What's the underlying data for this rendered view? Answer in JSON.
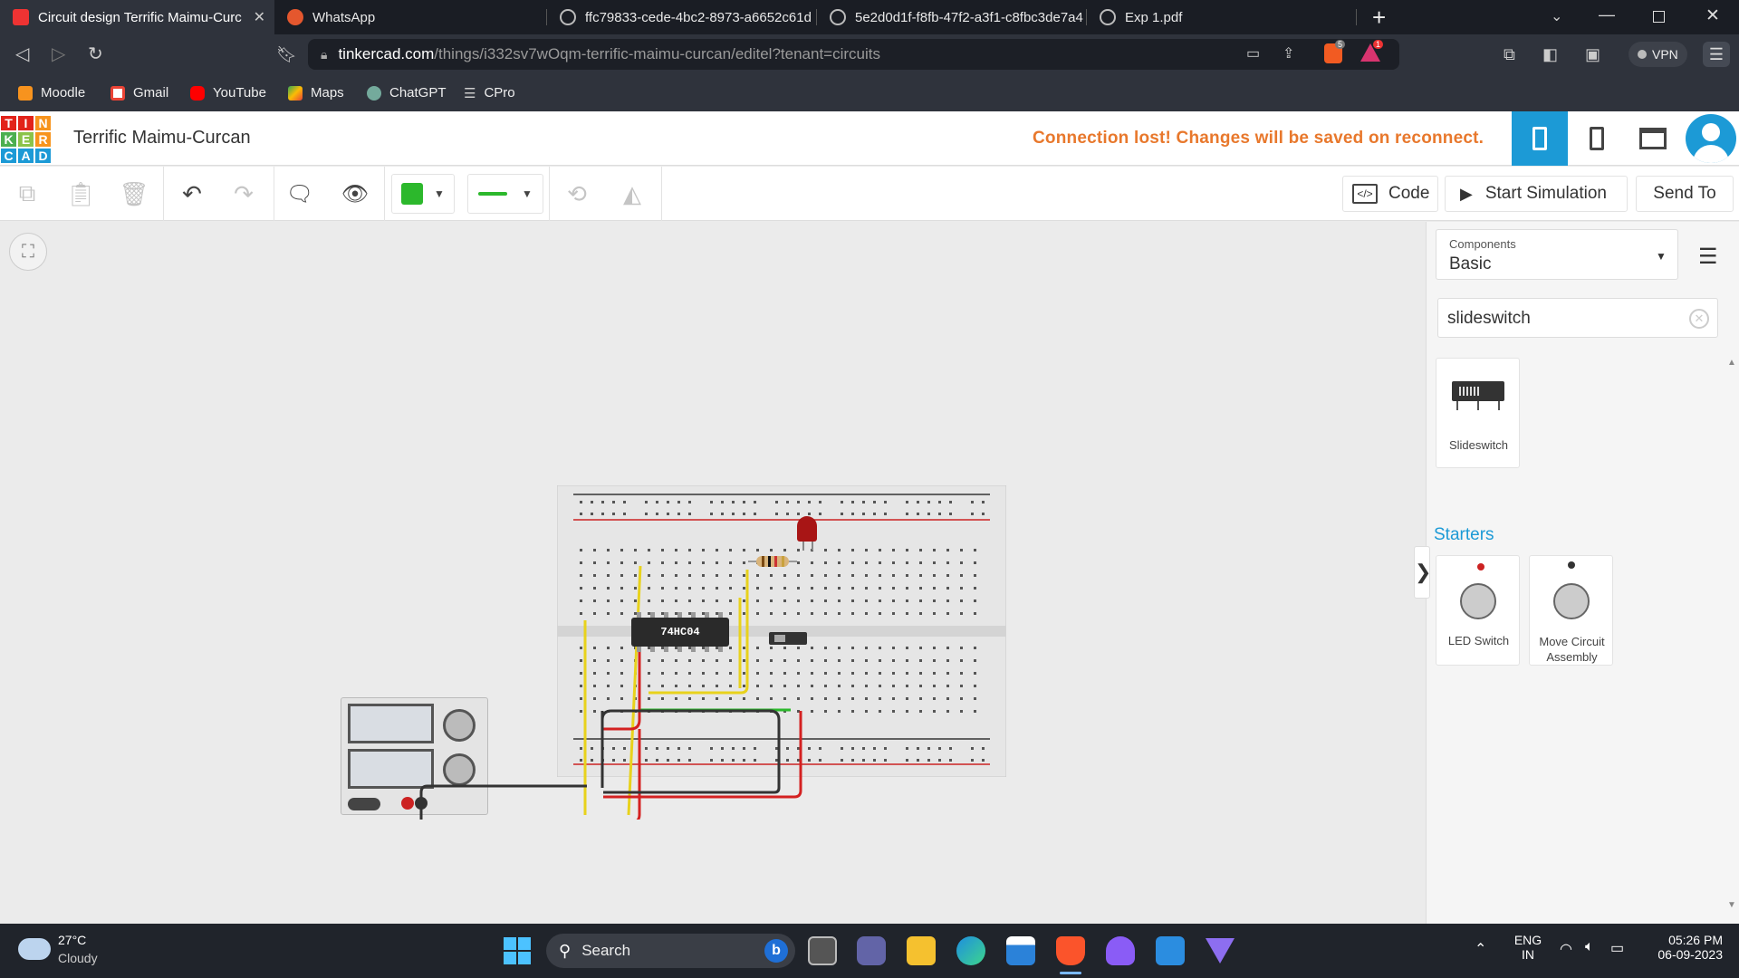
{
  "browser": {
    "tabs": [
      {
        "title": "Circuit design Terrific Maimu-Curc",
        "active": true
      },
      {
        "title": "WhatsApp",
        "active": false
      },
      {
        "title": "ffc79833-cede-4bc2-8973-a6652c61d",
        "active": false
      },
      {
        "title": "5e2d0d1f-f8fb-47f2-a3f1-c8fbc3de7a4",
        "active": false
      },
      {
        "title": "Exp 1.pdf",
        "active": false
      }
    ],
    "url_domain": "tinkercad.com",
    "url_path": "/things/i332sv7wOqm-terrific-maimu-curcan/editel?tenant=circuits",
    "vpn_label": "VPN",
    "brave_badge": "5",
    "alert_badge": "1",
    "bookmarks": [
      "Moodle",
      "Gmail",
      "YouTube",
      "Maps",
      "ChatGPT",
      "CPro"
    ]
  },
  "app": {
    "logo_letters": [
      "T",
      "I",
      "N",
      "K",
      "E",
      "R",
      "C",
      "A",
      "D"
    ],
    "title": "Terrific Maimu-Curcan",
    "status_message": "Connection lost! Changes will be saved on reconnect.",
    "code_label": "Code",
    "start_sim_label": "Start Simulation",
    "send_to_label": "Send To",
    "chip_label": "74HC04"
  },
  "panel": {
    "components_label": "Components",
    "components_value": "Basic",
    "search_value": "slideswitch",
    "results": [
      {
        "label": "Slideswitch"
      }
    ],
    "starters_title": "Starters",
    "starters": [
      {
        "label": "LED Switch"
      },
      {
        "label": "Move Circuit Assembly"
      }
    ]
  },
  "taskbar": {
    "temp": "27°C",
    "weather": "Cloudy",
    "search_placeholder": "Search",
    "lang_top": "ENG",
    "lang_bottom": "IN",
    "time": "05:26 PM",
    "date": "06-09-2023"
  },
  "colors": {
    "accent": "#1c9ad6",
    "warning": "#e8782c",
    "wire_red": "#d42121",
    "wire_black": "#333333",
    "wire_yellow": "#e8d21c",
    "wire_green": "#2cb82c"
  }
}
